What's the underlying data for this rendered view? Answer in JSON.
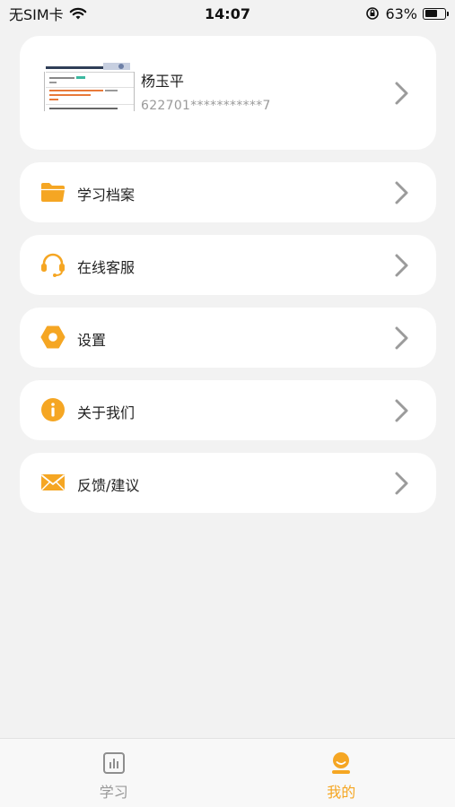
{
  "status_bar": {
    "carrier": "无SIM卡",
    "time": "14:07",
    "battery_percent": "63%",
    "battery_level": 0.63
  },
  "profile": {
    "name": "杨玉平",
    "id_masked": "622701***********7"
  },
  "menu": [
    {
      "label": "学习档案",
      "icon": "folder-icon"
    },
    {
      "label": "在线客服",
      "icon": "headset-icon"
    },
    {
      "label": "设置",
      "icon": "settings-hex-icon"
    },
    {
      "label": "关于我们",
      "icon": "info-icon"
    },
    {
      "label": "反馈/建议",
      "icon": "mail-icon"
    }
  ],
  "tabs": [
    {
      "label": "学习",
      "icon": "chart-icon",
      "active": false
    },
    {
      "label": "我的",
      "icon": "person-icon",
      "active": true
    }
  ],
  "colors": {
    "accent": "#f5a623",
    "background": "#f2f2f2",
    "card": "#ffffff",
    "chevron": "#9b9b9b"
  }
}
